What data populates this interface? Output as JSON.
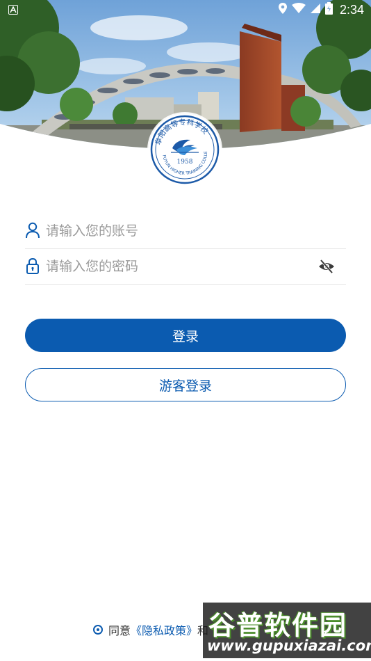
{
  "status_bar": {
    "time": "2:34",
    "icons": [
      "app-notification-icon",
      "location-icon",
      "wifi-icon",
      "cellular-signal-icon",
      "battery-icon"
    ]
  },
  "logo": {
    "name_calligraphy": "阜阳高等专科学校",
    "english": "FUYUN HIGHER TRAINING COLLEGE",
    "year": "1958"
  },
  "form": {
    "account_placeholder": "请输入您的账号",
    "password_placeholder": "请输入您的密码",
    "login_button": "登录",
    "guest_button": "游客登录"
  },
  "agreement": {
    "prefix": "同意",
    "privacy_link": "《隐私政策》",
    "suffix": "和"
  },
  "watermark": {
    "title": "谷普软件园",
    "url": "www.gupuxiazai.com"
  },
  "colors": {
    "primary": "#0b5bb0",
    "placeholder": "#9a9a9a",
    "divider": "#e6e6e6"
  }
}
